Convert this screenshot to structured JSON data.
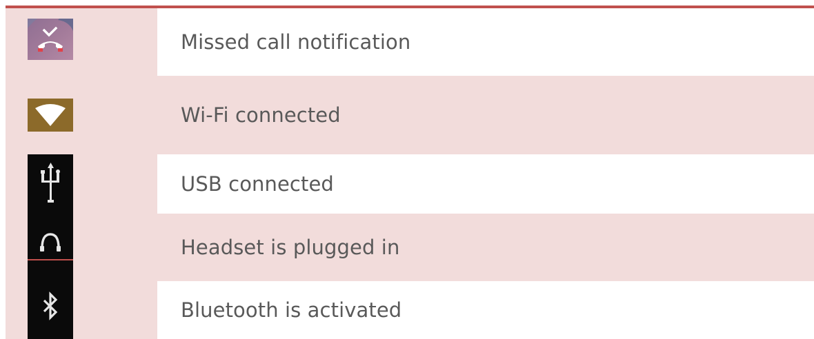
{
  "colors": {
    "accent_rule": "#c0504d",
    "shaded_row": "#f2dcdb",
    "text": "#595959",
    "wifi_tile": "#8c6a2a",
    "dark_tile": "#0a0a0a"
  },
  "rows": [
    {
      "icon": "missed-call-icon",
      "label": "Missed call notification",
      "shaded": false
    },
    {
      "icon": "wifi-icon",
      "label": "Wi-Fi connected",
      "shaded": true
    },
    {
      "icon": "usb-icon",
      "label": "USB connected",
      "shaded": false
    },
    {
      "icon": "headset-icon",
      "label": "Headset is plugged in",
      "shaded": true
    },
    {
      "icon": "bluetooth-icon",
      "label": "Bluetooth is activated",
      "shaded": false
    }
  ]
}
